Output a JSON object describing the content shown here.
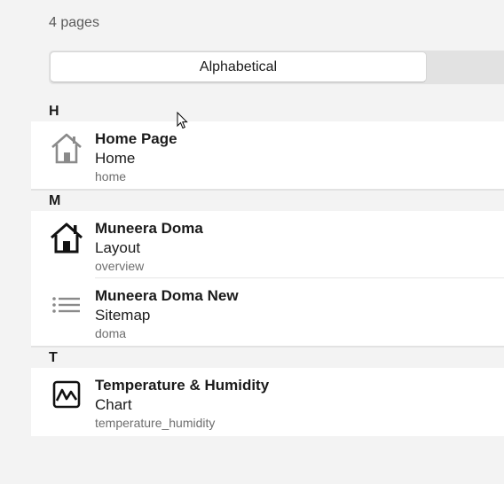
{
  "header": {
    "count": "4 pages"
  },
  "sort": {
    "selected": "Alphabetical"
  },
  "groups": [
    {
      "letter": "H",
      "items": [
        {
          "title": "Home Page",
          "subtitle": "Home",
          "meta": "home",
          "icon": "house-outline-icon"
        }
      ]
    },
    {
      "letter": "M",
      "items": [
        {
          "title": "Muneera Doma",
          "subtitle": "Layout",
          "meta": "overview",
          "icon": "house-filled-icon"
        },
        {
          "title": "Muneera Doma New",
          "subtitle": "Sitemap",
          "meta": "doma",
          "icon": "list-icon"
        }
      ]
    },
    {
      "letter": "T",
      "items": [
        {
          "title": "Temperature & Humidity",
          "subtitle": "Chart",
          "meta": "temperature_humidity",
          "icon": "chart-icon"
        }
      ]
    }
  ]
}
